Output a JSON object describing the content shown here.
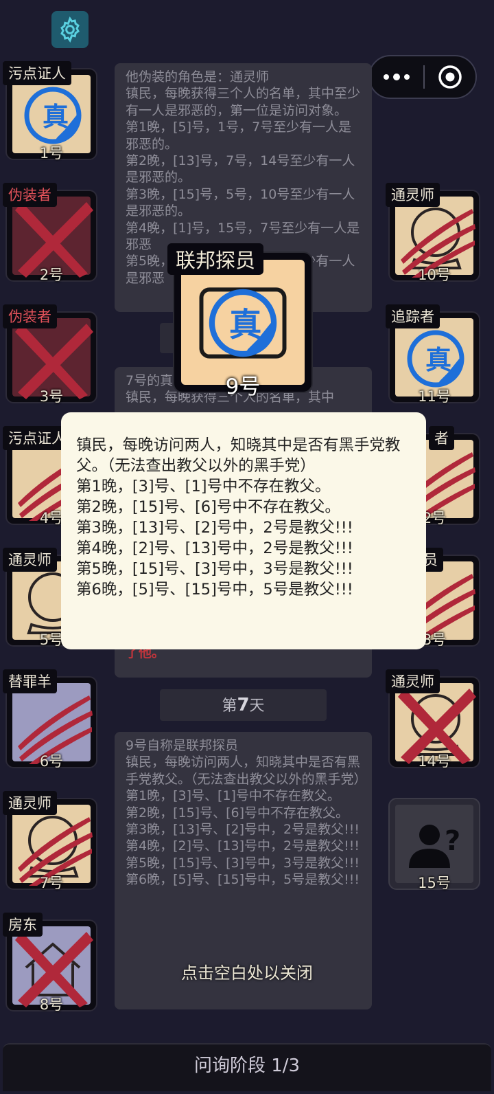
{
  "top_controls": {
    "settings_icon": "gear-icon",
    "menu_icon": "more-dots-icon",
    "record_icon": "record-circle-icon"
  },
  "players_left": [
    {
      "role": "污点证人",
      "number": "1号",
      "state": "verified"
    },
    {
      "role": "伪装者",
      "number": "2号",
      "state": "dead"
    },
    {
      "role": "伪装者",
      "number": "3号",
      "state": "dead"
    },
    {
      "role": "污点证人",
      "number": "4号",
      "state": "clawed"
    },
    {
      "role": "通灵师",
      "number": "5号",
      "state": "normal"
    },
    {
      "role": "替罪羊",
      "number": "6号",
      "state": "clawed"
    },
    {
      "role": "通灵师",
      "number": "7号",
      "state": "clawed"
    },
    {
      "role": "房东",
      "number": "8号",
      "state": "dead"
    }
  ],
  "players_right": [
    {
      "role": "通灵师",
      "number": "10号",
      "state": "clawed"
    },
    {
      "role": "追踪者",
      "number": "11号",
      "state": "verified"
    },
    {
      "role": "者",
      "number": "2号",
      "state": "clawed"
    },
    {
      "role": "员",
      "number": "3号",
      "state": "clawed"
    },
    {
      "role": "通灵师",
      "number": "14号",
      "state": "dead"
    },
    {
      "role": "",
      "number": "15号",
      "state": "unknown"
    }
  ],
  "log_panel_1": [
    "他伪装的角色是：通灵师",
    "镇民，每晚获得三个人的名单，其中至少有一人是邪恶的，第一位是访问对象。",
    "第1晚，[5]号，1号，7号至少有一人是邪恶的。",
    "第2晚，[13]号，7号，14号至少有一人是邪恶的。",
    "第3晚，[15]号，5号，10号至少有一人是邪恶的。",
    "第4晚，[1]号，15号，7号至少有一人是邪恶",
    "第5晚，[13]号，9号，15号至少有一人是邪恶"
  ],
  "log_panel_2": [
    "7号的真",
    "镇民，每晚获得三个人的名单，其中"
  ],
  "log_panel_2_tail": "了他。",
  "day_label_prefix": "第",
  "day_label_number": "7",
  "day_label_suffix": "天",
  "log_panel_3": [
    "9号自称是联邦探员",
    "镇民，每晚访问两人，知晓其中是否有黑手党教父。（无法查出教父以外的黑手党）",
    "第1晚，[3]号、[1]号中不存在教父。",
    "第2晚，[15]号、[6]号中不存在教父。",
    "第3晚，[13]号、[2]号中，2号是教父!!!",
    "第4晚，[2]号、[13]号中，2号是教父!!!",
    "第5晚，[15]号、[3]号中，3号是教父!!!",
    "第6晚，[5]号、[15]号中，5号是教父!!!"
  ],
  "featured_card": {
    "role": "联邦探员",
    "number": "9号",
    "badge": "真"
  },
  "tooltip": {
    "lines": [
      "镇民，每晚访问两人，知晓其中是否有黑手党教父。（无法查出教父以外的黑手党）",
      "第1晚，[3]号、[1]号中不存在教父。",
      "第2晚，[15]号、[6]号中不存在教父。",
      "第3晚，[13]号、[2]号中，2号是教父!!!",
      "第4晚，[2]号、[13]号中，2号是教父!!!",
      "第5晚，[15]号、[3]号中，3号是教父!!!",
      "第6晚，[5]号、[15]号中，5号是教父!!!"
    ]
  },
  "verified_badge": "真",
  "close_hint": "点击空白处以关闭",
  "phase_label": "问询阶段 1/3",
  "colors": {
    "background": "#1c1b2e",
    "dead_card": "#5d2430",
    "claw": "#b0283a",
    "badge_blue": "#1e6fd9",
    "tooltip_bg": "#fbf8e8"
  }
}
